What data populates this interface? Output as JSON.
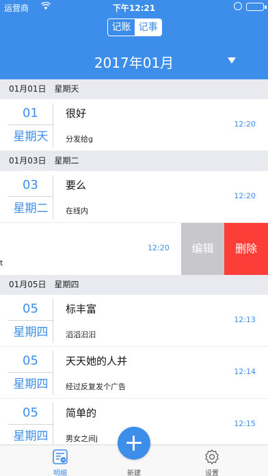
{
  "status_bar": {
    "carrier": "运营商",
    "time": "下午12:21"
  },
  "segment": {
    "options": [
      "记账",
      "记事"
    ],
    "selected": "记事"
  },
  "month_picker": {
    "label": "2017年01月"
  },
  "sections": [
    {
      "date": "01月01日",
      "weekday": "星期天"
    },
    {
      "date": "01月03日",
      "weekday": "星期二"
    },
    {
      "date": "01月05日",
      "weekday": "星期四"
    }
  ],
  "entries": [
    {
      "day": "01",
      "week": "星期天",
      "title": "很好",
      "subtitle": "分发给g",
      "time": "12:20"
    },
    {
      "day": "03",
      "week": "星期二",
      "title": "要么",
      "subtitle": "在线内",
      "time": "12:20"
    },
    {
      "day": "05",
      "week": "星期四",
      "title": "标丰富",
      "subtitle": "滔滔汩汩",
      "time": "12:13"
    },
    {
      "day": "05",
      "week": "星期四",
      "title": "天天她的人并",
      "subtitle": "经过反复发个广告",
      "time": "12:14"
    },
    {
      "day": "05",
      "week": "星期四",
      "title": "简单的",
      "subtitle": "男女之间j",
      "time": "12:15"
    }
  ],
  "swiped_row": {
    "cut_text": "t",
    "time": "12:20",
    "edit_label": "编辑",
    "delete_label": "删除"
  },
  "tabbar": {
    "detail": "明细",
    "new": "新建",
    "settings": "设置"
  },
  "colors": {
    "accent": "#3d8eea",
    "delete": "#fc3d38",
    "edit": "#c7c7cc"
  }
}
